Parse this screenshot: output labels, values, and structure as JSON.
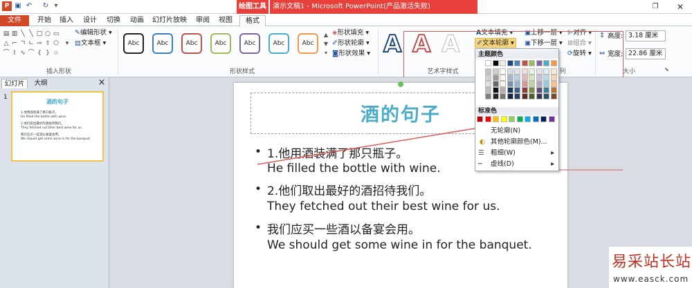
{
  "titlebar": {
    "quick_access": [
      "ppt-logo-icon",
      "save-icon",
      "undo-icon",
      "redo-icon",
      "customize-icon"
    ],
    "drawing_tools": "绘图工具",
    "doc_title": "演示文稿1 - Microsoft PowerPoint(产品激活失败)"
  },
  "tabs": [
    "文件",
    "开始",
    "插入",
    "设计",
    "切换",
    "动画",
    "幻灯片放映",
    "审阅",
    "视图",
    "格式"
  ],
  "groups": {
    "insert_shapes": "插入形状",
    "shape_styles": "形状样式",
    "wordart": "艺术字样式",
    "size": "大小",
    "arrange_partial": "列"
  },
  "insert_shapes": {
    "edit_shape": "编辑形状",
    "text_box": "文本框"
  },
  "shape_styles": {
    "abc": [
      "Abc",
      "Abc",
      "Abc",
      "Abc",
      "Abc",
      "Abc",
      "Abc"
    ],
    "abc_colors": [
      "#222222",
      "#3a7cc7",
      "#c0504d",
      "#9bbb59",
      "#8064a2",
      "#4bacc6",
      "#f79646"
    ],
    "fill": "形状填充",
    "outline": "形状轮廓",
    "effects": "形状效果"
  },
  "wordart": {
    "letters": [
      "A",
      "A",
      "A"
    ],
    "text_fill": "文本填充",
    "text_outline": "文本轮廓"
  },
  "arrange": {
    "bring_forward": "上移一层",
    "send_backward": "下移一层",
    "align": "对齐",
    "group": "组合",
    "rotate": "旋转"
  },
  "size": {
    "height_label": "高度:",
    "height": "3.18 厘米",
    "width_label": "宽度:",
    "width": "22.86 厘米"
  },
  "dropdown": {
    "theme_colors": "主题颜色",
    "standard_colors": "标准色",
    "no_outline": "无轮廓(N)",
    "more_colors": "其他轮廓颜色(M)...",
    "weight": "粗细(W)",
    "dashes": "虚线(D)",
    "theme_row": [
      "#ffffff",
      "#000000",
      "#eeece1",
      "#1f497d",
      "#4f81bd",
      "#c0504d",
      "#9bbb59",
      "#8064a2",
      "#4bacc6",
      "#f79646"
    ],
    "standard_row": [
      "#c00000",
      "#ff0000",
      "#ffc000",
      "#ffff00",
      "#92d050",
      "#00b050",
      "#00b0f0",
      "#0070c0",
      "#002060",
      "#7030a0"
    ]
  },
  "left_panel": {
    "tab_slides": "幻灯片",
    "tab_outline": "大纲",
    "close": "×",
    "slide_number": "1"
  },
  "slide": {
    "title": "酒的句子",
    "bullets": [
      {
        "cn": "1.他用酒装满了那只瓶子。",
        "en": "He filled the bottle with wine."
      },
      {
        "cn": "2.他们取出最好的酒招待我们。",
        "en": "They fetched out their best wine for us."
      },
      {
        "cn": "我们应买一些酒以备宴会用。",
        "en": "We should get some wine in for the banquet."
      }
    ]
  },
  "watermark": {
    "cn": "易采站长站",
    "url": "www.easck.com"
  }
}
